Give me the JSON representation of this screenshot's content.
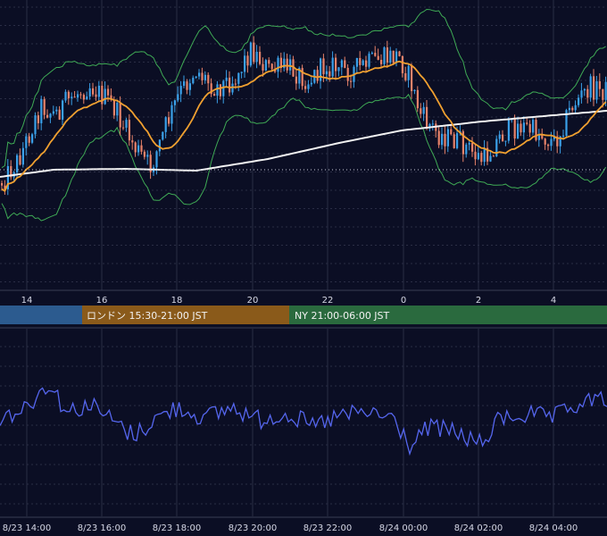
{
  "colors": {
    "background": "#0b0e24",
    "grid": "#2a2d45",
    "candle_up": "#3aa0e8",
    "candle_down": "#e8836a",
    "ma_fast": "#f0a030",
    "ma_slow": "#f2f2f2",
    "bollinger": "#3faa55",
    "oscillator": "#5566ee",
    "session_tokyo": "#2c5b8f",
    "session_london": "#8a5a1a",
    "session_ny": "#2a6a3e"
  },
  "chart_data": [
    {
      "type": "candlestick",
      "title": "",
      "x_tick_labels": [
        "14",
        "16",
        "18",
        "20",
        "22",
        "0",
        "2",
        "4"
      ],
      "overlays": [
        "bollinger-bands",
        "moving-average-fast",
        "moving-average-slow"
      ],
      "reference_line": "dotted horizontal",
      "grid": true
    },
    {
      "type": "line",
      "title": "",
      "x_tick_labels": [
        "8/23 14:00",
        "8/23 16:00",
        "8/23 18:00",
        "8/23 20:00",
        "8/23 22:00",
        "8/24 00:00",
        "8/24 02:00",
        "8/24 04:00"
      ],
      "grid": true
    }
  ],
  "sessions": [
    {
      "label": ""
    },
    {
      "label": "ロンドン 15:30-21:00 JST"
    },
    {
      "label": "NY 21:00-06:00 JST"
    }
  ]
}
